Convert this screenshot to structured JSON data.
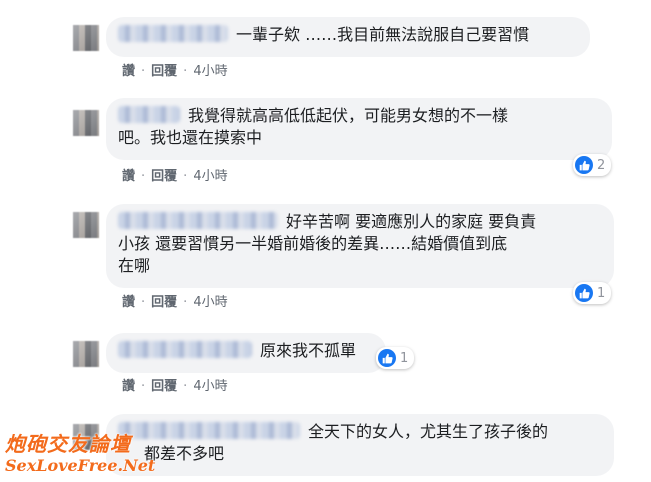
{
  "comments": [
    {
      "text": "一輩子欸 ……我目前無法說服自己要習慣",
      "actions": {
        "read": "讚",
        "reply": "回覆",
        "time": "4小時"
      }
    },
    {
      "line1": "我覺得就高高低低起伏，可能男女想的不一樣",
      "line2": "吧。我也還在摸索中",
      "actions": {
        "read": "讚",
        "reply": "回覆",
        "time": "4小時"
      },
      "reactions": "2"
    },
    {
      "line1": "好辛苦啊 要適應別人的家庭 要負責",
      "line2": "小孩 還要習慣另一半婚前婚後的差異……結婚價值到底",
      "line3": "在哪",
      "actions": {
        "read": "讚",
        "reply": "回覆",
        "time": "4小時"
      },
      "reactions": "1"
    },
    {
      "text": "原來我不孤單",
      "actions": {
        "read": "讚",
        "reply": "回覆",
        "time": "4小時"
      },
      "reactions": "1"
    },
    {
      "line1": "全天下的女人，尤其生了孩子後的",
      "line2": "都差不多吧"
    }
  ],
  "watermark": {
    "title": "炮砲交友論壇",
    "site": "SexLoveFree.Net"
  },
  "icons": {
    "like": "thumbs-up-icon"
  },
  "colors": {
    "bubble": "#f2f3f5",
    "like": "#1877f2",
    "watermark": "#f36b1c"
  }
}
